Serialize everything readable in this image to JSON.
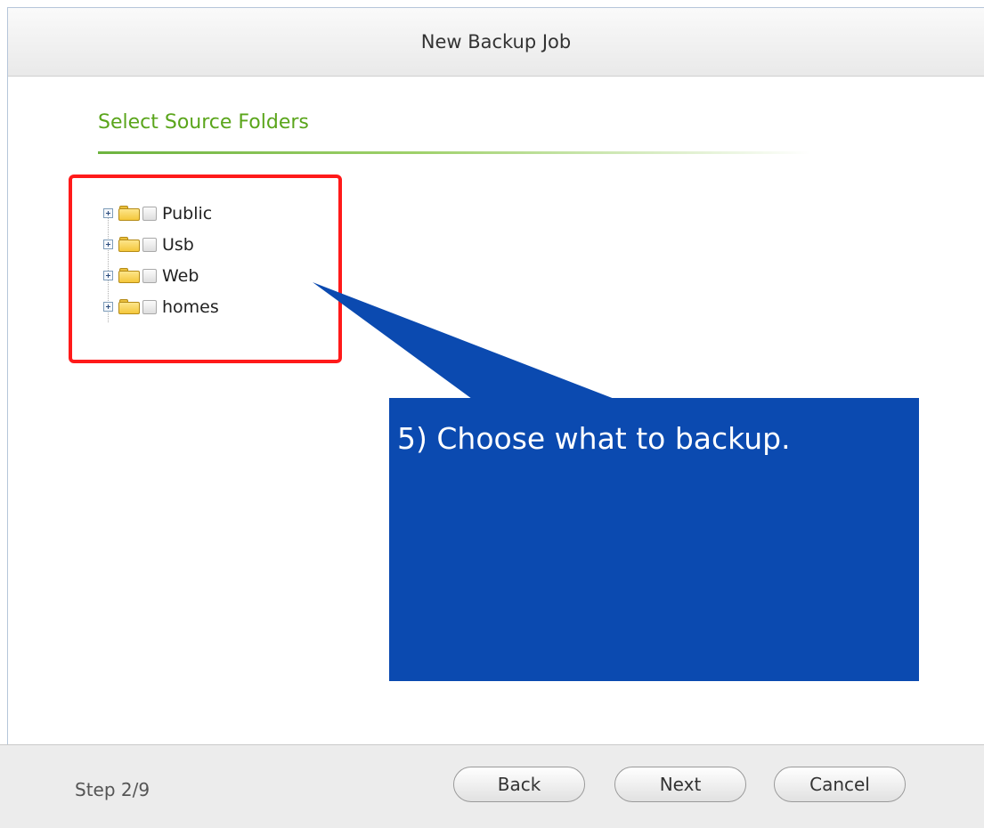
{
  "dialog": {
    "title": "New Backup Job"
  },
  "section": {
    "title": "Select Source Folders"
  },
  "folders": [
    {
      "label": "Public",
      "icon": "folder-icon"
    },
    {
      "label": "Usb",
      "icon": "folder-icon"
    },
    {
      "label": "Web",
      "icon": "folder-icon"
    },
    {
      "label": "homes",
      "icon": "folder-icon"
    }
  ],
  "callout": {
    "text": "5) Choose what to backup.",
    "color": "#0b4ab0"
  },
  "highlight": {
    "color": "#ff1a1a"
  },
  "footer": {
    "step": "Step 2/9",
    "back_label": "Back",
    "next_label": "Next",
    "cancel_label": "Cancel"
  }
}
